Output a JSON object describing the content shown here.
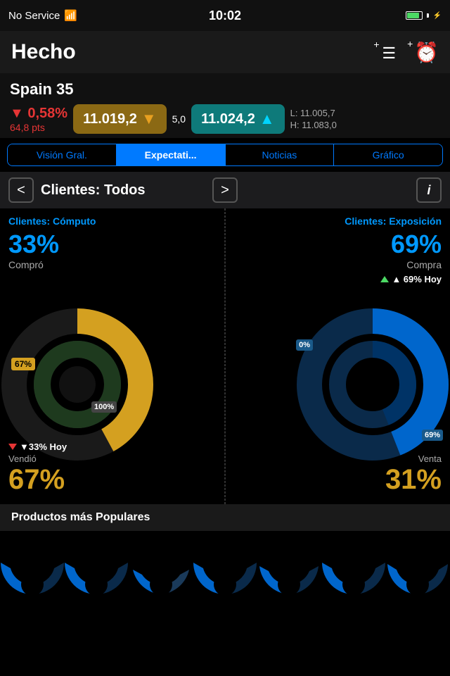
{
  "status_bar": {
    "signal": "No Service",
    "wifi": "📶",
    "time": "10:02",
    "battery_level": 80
  },
  "header": {
    "title": "Hecho",
    "add_list_label": "+≡",
    "add_alarm_label": "+⏰"
  },
  "stock": {
    "name": "Spain 35",
    "change_pct": "▼ 0,58%",
    "change_pts": "64,8 pts",
    "price_low_label": "L: 11.005,7",
    "price_high_label": "H: 11.083,0",
    "price_mid": "5,0",
    "price_gold": "11.019,2",
    "price_teal": "11.024,2"
  },
  "tabs": [
    {
      "label": "Visión Gral.",
      "active": false
    },
    {
      "label": "Expectati...",
      "active": true
    },
    {
      "label": "Noticias",
      "active": false
    },
    {
      "label": "Gráfico",
      "active": false
    }
  ],
  "nav": {
    "title": "Clientes: Todos",
    "prev": "<",
    "next": ">",
    "info": "i"
  },
  "left_chart": {
    "title": "Clientes: Cómputo",
    "pct_top": "33%",
    "label_top": "Compró",
    "pct_bottom": "67%",
    "label_bottom": "Vendió",
    "badge_33": "▼33% Hoy",
    "donut_gold": 67,
    "donut_dark": 33,
    "label_67": "67%",
    "label_100": "100%"
  },
  "right_chart": {
    "title": "Clientes: Exposición",
    "pct_top": "69%",
    "label_top": "Compra",
    "badge_69_hoy": "▲ 69% Hoy",
    "pct_bottom": "31%",
    "label_bottom": "Venta",
    "label_0": "0%",
    "label_69": "69%"
  },
  "popular_bar": {
    "label": "Productos más Populares"
  },
  "colors": {
    "blue": "#0099ff",
    "gold": "#d4a020",
    "red": "#e63535",
    "teal": "#0e7a7a",
    "green": "#4cd964"
  }
}
